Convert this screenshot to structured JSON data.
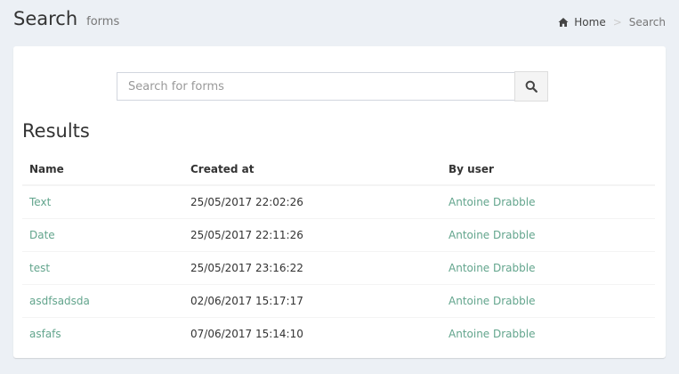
{
  "header": {
    "title": "Search",
    "subtitle": "forms"
  },
  "breadcrumb": {
    "home_icon": "home-icon",
    "home": "Home",
    "separator": ">",
    "current": "Search"
  },
  "search": {
    "placeholder": "Search for forms",
    "value": "",
    "button_icon": "search-icon"
  },
  "results": {
    "title": "Results",
    "columns": [
      "Name",
      "Created at",
      "By user"
    ],
    "rows": [
      {
        "name": "Text",
        "created_at": "25/05/2017 22:02:26",
        "user": "Antoine Drabble"
      },
      {
        "name": "Date",
        "created_at": "25/05/2017 22:11:26",
        "user": "Antoine Drabble"
      },
      {
        "name": "test",
        "created_at": "25/05/2017 23:16:22",
        "user": "Antoine Drabble"
      },
      {
        "name": "asdfsadsda",
        "created_at": "02/06/2017 15:17:17",
        "user": "Antoine Drabble"
      },
      {
        "name": "asfafs",
        "created_at": "07/06/2017 15:14:10",
        "user": "Antoine Drabble"
      }
    ]
  },
  "colors": {
    "background": "#ecf0f5",
    "link": "#63a58d",
    "box": "#ffffff"
  }
}
